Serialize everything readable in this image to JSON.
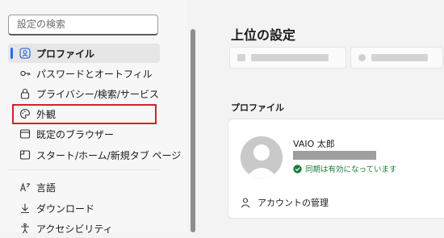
{
  "search": {
    "placeholder": "設定の検索"
  },
  "sidebar": {
    "items": [
      {
        "label": "プロファイル",
        "icon": "profile-icon",
        "selected": true
      },
      {
        "label": "パスワードとオートフィル",
        "icon": "key-icon"
      },
      {
        "label": "プライバシー/検索/サービス",
        "icon": "lock-icon"
      },
      {
        "label": "外観",
        "icon": "palette-icon",
        "highlighted": true
      },
      {
        "label": "既定のブラウザー",
        "icon": "browser-icon"
      },
      {
        "label": "スタート/ホーム/新規タブ ページ",
        "icon": "home-icon"
      },
      {
        "label": "言語",
        "icon": "language-icon"
      },
      {
        "label": "ダウンロード",
        "icon": "download-icon"
      },
      {
        "label": "アクセシビリティ",
        "icon": "accessibility-icon"
      }
    ]
  },
  "main": {
    "page_title": "上位の設定",
    "section_title": "プロファイル",
    "profile": {
      "name": "VAIO 太郎",
      "sync_status": "同期は有効になっています",
      "manage_account": "アカウントの管理"
    }
  },
  "colors": {
    "accent": "#1a73e8",
    "highlight_border": "#d3222a",
    "sync_green": "#1d7d3a"
  }
}
